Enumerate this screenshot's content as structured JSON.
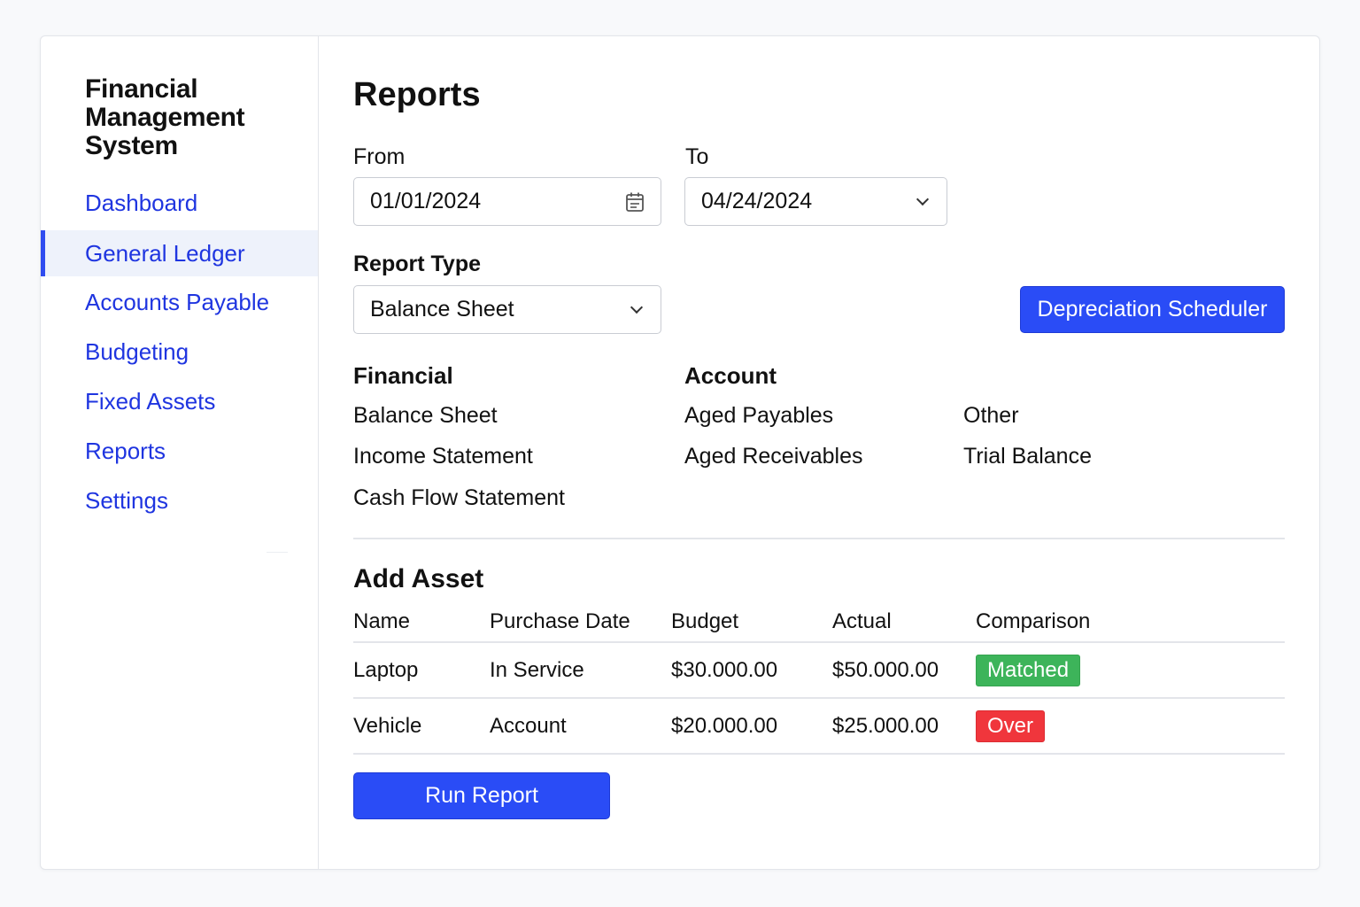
{
  "app": {
    "title": "Financial Management System"
  },
  "sidebar": {
    "items": [
      {
        "label": "Dashboard",
        "active": false
      },
      {
        "label": "General Ledger",
        "active": true
      },
      {
        "label": "Accounts Payable",
        "active": false
      },
      {
        "label": "Budgeting",
        "active": false
      },
      {
        "label": "Fixed Assets",
        "active": false
      },
      {
        "label": "Reports",
        "active": false
      },
      {
        "label": "Settings",
        "active": false
      }
    ]
  },
  "page": {
    "title": "Reports"
  },
  "filters": {
    "from_label": "From",
    "from_value": "01/01/2024",
    "from_icon": "calendar-icon",
    "to_label": "To",
    "to_value": "04/24/2024",
    "to_icon": "chevron-down-icon",
    "report_type_label": "Report Type",
    "report_type_value": "Balance Sheet",
    "report_type_icon": "chevron-down-icon"
  },
  "actions": {
    "depreciation_label": "Depreciation Scheduler",
    "run_report_label": "Run Report"
  },
  "report_groups": {
    "financial": {
      "heading": "Financial",
      "items": [
        "Balance Sheet",
        "Income Statement",
        "Cash Flow Statement"
      ]
    },
    "account": {
      "heading": "Account",
      "items": [
        "Aged Payables",
        "Aged Receivables"
      ]
    },
    "other": {
      "items": [
        "Other",
        "Trial Balance"
      ]
    }
  },
  "asset_table": {
    "title": "Add Asset",
    "columns": [
      "Name",
      "Purchase Date",
      "Budget",
      "Actual",
      "Comparison"
    ],
    "rows": [
      {
        "name": "Laptop",
        "purchase_date": "In Service",
        "budget": "$30.000.00",
        "actual": "$50.000.00",
        "comparison": "Matched",
        "comparison_color": "#3db45a"
      },
      {
        "name": "Vehicle",
        "purchase_date": "Account",
        "budget": "$20.000.00",
        "actual": "$25.000.00",
        "comparison": "Over",
        "comparison_color": "#f0363c"
      }
    ]
  },
  "colors": {
    "accent": "#2a4cf6",
    "nav_link": "#1f35e0",
    "matched": "#3db45a",
    "over": "#f0363c"
  }
}
